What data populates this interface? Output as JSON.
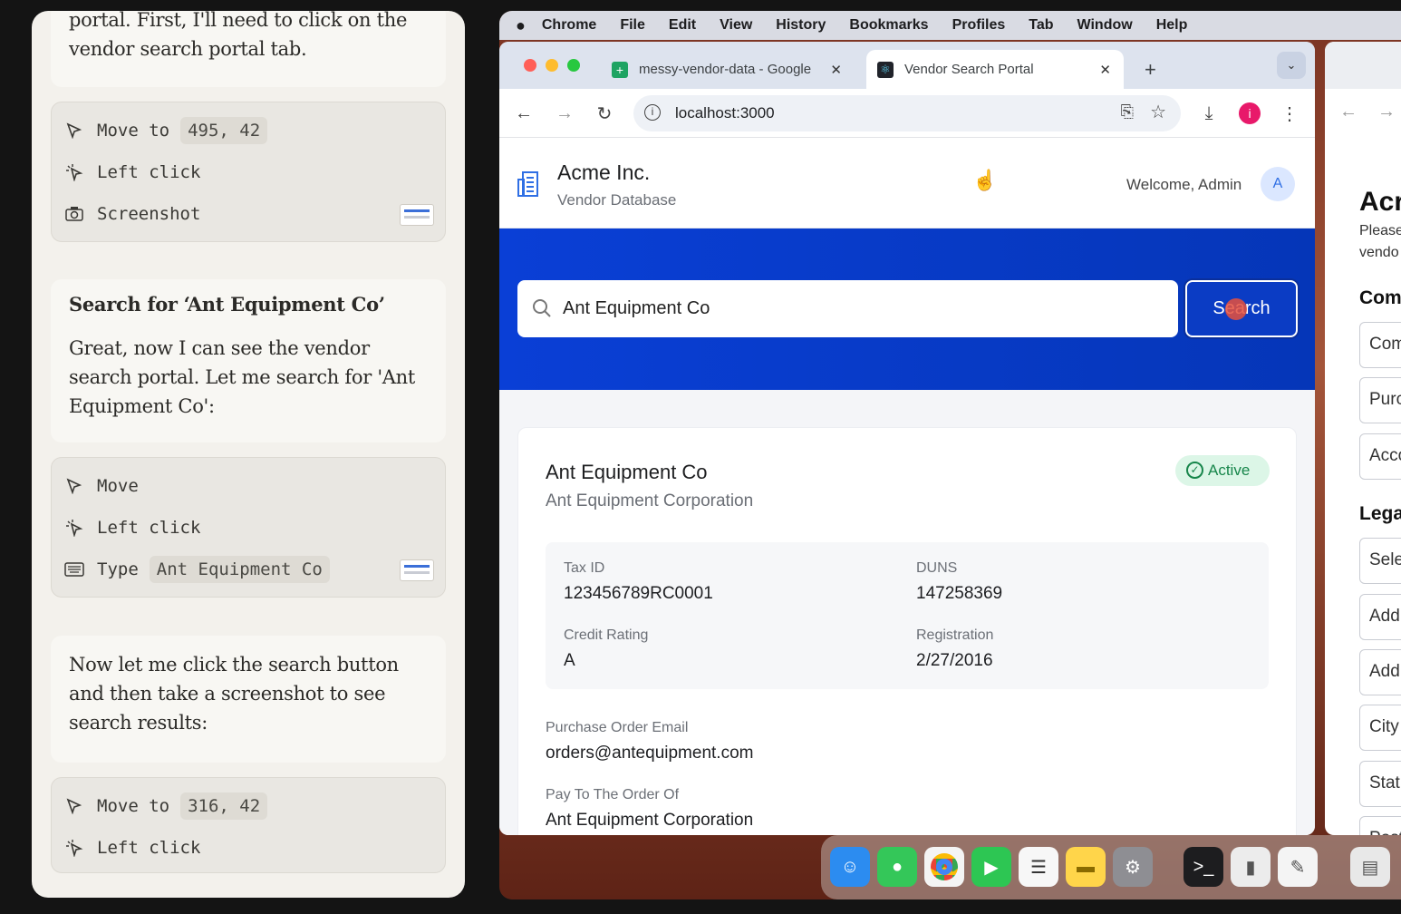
{
  "chat": {
    "msg1_text": "portal. First, I'll need to click on the vendor search portal tab.",
    "tools1": [
      {
        "action": "Move to",
        "arg": "495, 42",
        "icon": "cursor-icon"
      },
      {
        "action": "Left click",
        "arg": "",
        "icon": "click-icon"
      },
      {
        "action": "Screenshot",
        "arg": "",
        "icon": "camera-icon"
      }
    ],
    "msg2_title": "Search for ‘Ant Equipment Co’",
    "msg2_text": "Great, now I can see the vendor search portal. Let me search for 'Ant Equipment Co':",
    "tools2": [
      {
        "action": "Move",
        "arg": "",
        "icon": "cursor-icon"
      },
      {
        "action": "Left click",
        "arg": "",
        "icon": "click-icon"
      },
      {
        "action": "Type",
        "arg": "Ant Equipment Co",
        "icon": "keyboard-icon"
      }
    ],
    "msg3_text": "Now let me click the search button and then take a screenshot to see search results:",
    "tools3": [
      {
        "action": "Move to",
        "arg": "316, 42",
        "icon": "cursor-icon"
      },
      {
        "action": "Left click",
        "arg": "",
        "icon": "click-icon"
      }
    ]
  },
  "menubar": {
    "app": "Chrome",
    "items": [
      "File",
      "Edit",
      "View",
      "History",
      "Bookmarks",
      "Profiles",
      "Tab",
      "Window",
      "Help"
    ]
  },
  "browser": {
    "tabs": [
      {
        "title": "messy-vendor-data - Google",
        "icon": "sheets-icon"
      },
      {
        "title": "Vendor Search Portal",
        "icon": "react-icon"
      }
    ],
    "url": "localhost:3000",
    "profile_initial": "i"
  },
  "app": {
    "company": "Acme Inc.",
    "subtitle": "Vendor Database",
    "welcome": "Welcome, Admin",
    "avatar": "A",
    "search_value": "Ant Equipment Co",
    "search_button": "Search"
  },
  "result": {
    "name": "Ant Equipment Co",
    "legal_name": "Ant Equipment Corporation",
    "status": "Active",
    "tax_id_label": "Tax ID",
    "tax_id": "123456789RC0001",
    "duns_label": "DUNS",
    "duns": "147258369",
    "credit_label": "Credit Rating",
    "credit": "A",
    "reg_label": "Registration",
    "reg": "2/27/2016",
    "po_email_label": "Purchase Order Email",
    "po_email": "orders@antequipment.com",
    "pay_to_label": "Pay To The Order Of",
    "pay_to": "Ant Equipment Corporation"
  },
  "window2": {
    "title": "Acr",
    "line1": "Please",
    "line2": "vendo",
    "section1": "Com",
    "fields1": [
      "Com",
      "Purc",
      "Acco"
    ],
    "section2": "Lega",
    "fields2": [
      "Sele",
      "Add",
      "Add",
      "City",
      "Stat",
      "Post"
    ]
  },
  "colors": {
    "accent": "#0a3fd6",
    "active_green": "#17864b"
  }
}
